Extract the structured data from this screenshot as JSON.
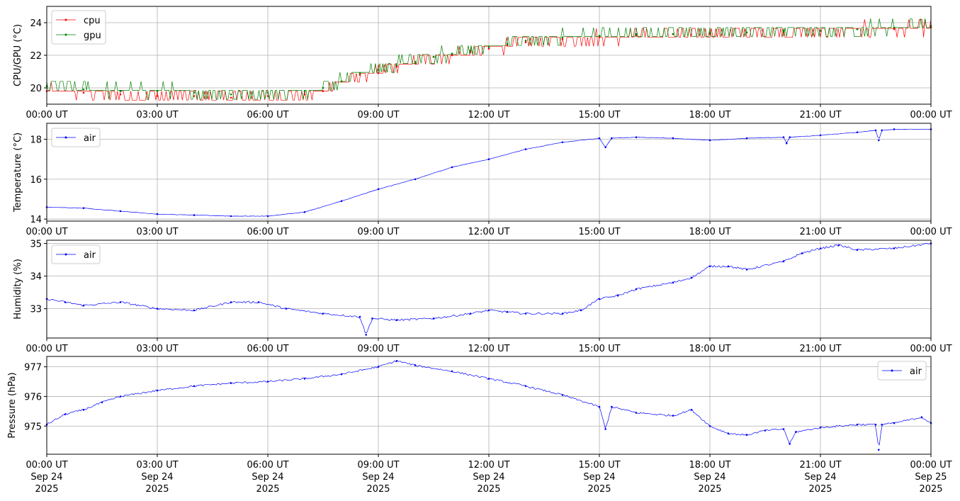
{
  "chart_data": [
    {
      "type": "line",
      "ylabel": "CPU/GPU (°C)",
      "ylim": [
        19.0,
        25.0
      ],
      "yticks": [
        20,
        22,
        24
      ],
      "xlim": [
        "2025-09-24 00:00",
        "2025-09-25 00:00"
      ],
      "xticks": [
        "00:00 UT",
        "03:00 UT",
        "06:00 UT",
        "09:00 UT",
        "12:00 UT",
        "15:00 UT",
        "18:00 UT",
        "21:00 UT",
        "00:00 UT"
      ],
      "grid": true,
      "legend": "top-left",
      "series": [
        {
          "name": "cpu",
          "color": "#ff0000",
          "points": [
            [
              "00:00",
              19.8
            ],
            [
              "01:00",
              19.7
            ],
            [
              "02:00",
              19.6
            ],
            [
              "03:00",
              19.5
            ],
            [
              "04:00",
              19.5
            ],
            [
              "05:00",
              19.4
            ],
            [
              "06:00",
              19.5
            ],
            [
              "07:00",
              19.6
            ],
            [
              "07:30",
              19.8
            ],
            [
              "08:00",
              20.4
            ],
            [
              "08:30",
              20.8
            ],
            [
              "09:00",
              20.9
            ],
            [
              "09:30",
              21.3
            ],
            [
              "10:00",
              21.5
            ],
            [
              "10:30",
              21.9
            ],
            [
              "11:00",
              22.0
            ],
            [
              "11:30",
              22.2
            ],
            [
              "12:00",
              22.4
            ],
            [
              "12:30",
              22.6
            ],
            [
              "13:00",
              22.8
            ],
            [
              "14:00",
              23.0
            ],
            [
              "15:00",
              23.1
            ],
            [
              "16:00",
              23.2
            ],
            [
              "17:00",
              23.3
            ],
            [
              "18:00",
              23.3
            ],
            [
              "19:00",
              23.4
            ],
            [
              "20:00",
              23.4
            ],
            [
              "21:00",
              23.5
            ],
            [
              "22:00",
              23.6
            ],
            [
              "23:00",
              23.6
            ],
            [
              "24:00",
              23.7
            ]
          ]
        },
        {
          "name": "gpu",
          "color": "#008000",
          "points": [
            [
              "00:00",
              20.1
            ],
            [
              "01:00",
              19.9
            ],
            [
              "02:00",
              19.8
            ],
            [
              "03:00",
              19.8
            ],
            [
              "04:00",
              19.7
            ],
            [
              "05:00",
              19.6
            ],
            [
              "06:00",
              19.7
            ],
            [
              "07:00",
              19.8
            ],
            [
              "07:30",
              20.0
            ],
            [
              "08:00",
              20.4
            ],
            [
              "08:30",
              20.9
            ],
            [
              "09:00",
              21.1
            ],
            [
              "09:30",
              21.4
            ],
            [
              "10:00",
              21.6
            ],
            [
              "10:30",
              21.9
            ],
            [
              "11:00",
              22.1
            ],
            [
              "11:30",
              22.3
            ],
            [
              "12:00",
              22.5
            ],
            [
              "12:30",
              22.7
            ],
            [
              "13:00",
              22.9
            ],
            [
              "14:00",
              23.1
            ],
            [
              "15:00",
              23.2
            ],
            [
              "16:00",
              23.3
            ],
            [
              "17:00",
              23.3
            ],
            [
              "18:00",
              23.4
            ],
            [
              "19:00",
              23.4
            ],
            [
              "20:00",
              23.5
            ],
            [
              "21:00",
              23.5
            ],
            [
              "22:00",
              23.6
            ],
            [
              "23:00",
              23.7
            ],
            [
              "24:00",
              23.8
            ]
          ]
        }
      ]
    },
    {
      "type": "line",
      "ylabel": "Temperature (°C)",
      "ylim": [
        13.9,
        18.8
      ],
      "yticks": [
        14,
        16,
        18
      ],
      "xlim": [
        "2025-09-24 00:00",
        "2025-09-25 00:00"
      ],
      "xticks": [
        "00:00 UT",
        "03:00 UT",
        "06:00 UT",
        "09:00 UT",
        "12:00 UT",
        "15:00 UT",
        "18:00 UT",
        "21:00 UT",
        "00:00 UT"
      ],
      "grid": true,
      "legend": "top-left",
      "series": [
        {
          "name": "air",
          "color": "#0000ff",
          "points": [
            [
              "00:00",
              14.6
            ],
            [
              "01:00",
              14.55
            ],
            [
              "02:00",
              14.4
            ],
            [
              "03:00",
              14.25
            ],
            [
              "04:00",
              14.2
            ],
            [
              "05:00",
              14.15
            ],
            [
              "06:00",
              14.15
            ],
            [
              "07:00",
              14.35
            ],
            [
              "08:00",
              14.9
            ],
            [
              "09:00",
              15.5
            ],
            [
              "10:00",
              16.0
            ],
            [
              "11:00",
              16.6
            ],
            [
              "12:00",
              17.0
            ],
            [
              "13:00",
              17.5
            ],
            [
              "14:00",
              17.85
            ],
            [
              "15:00",
              18.05
            ],
            [
              "15:10",
              17.6
            ],
            [
              "15:20",
              18.05
            ],
            [
              "16:00",
              18.1
            ],
            [
              "17:00",
              18.05
            ],
            [
              "18:00",
              17.95
            ],
            [
              "19:00",
              18.05
            ],
            [
              "20:00",
              18.1
            ],
            [
              "20:05",
              17.8
            ],
            [
              "20:10",
              18.1
            ],
            [
              "21:00",
              18.2
            ],
            [
              "22:00",
              18.35
            ],
            [
              "22:30",
              18.45
            ],
            [
              "22:35",
              17.95
            ],
            [
              "22:40",
              18.45
            ],
            [
              "23:00",
              18.5
            ],
            [
              "24:00",
              18.5
            ]
          ]
        }
      ]
    },
    {
      "type": "line",
      "ylabel": "Humidity (%)",
      "ylim": [
        32.1,
        35.1
      ],
      "yticks": [
        33,
        34,
        35
      ],
      "xlim": [
        "2025-09-24 00:00",
        "2025-09-25 00:00"
      ],
      "xticks": [
        "00:00 UT",
        "03:00 UT",
        "06:00 UT",
        "09:00 UT",
        "12:00 UT",
        "15:00 UT",
        "18:00 UT",
        "21:00 UT",
        "00:00 UT"
      ],
      "grid": true,
      "legend": "top-left",
      "series": [
        {
          "name": "air",
          "color": "#0000ff",
          "points": [
            [
              "00:00",
              33.3
            ],
            [
              "00:30",
              33.2
            ],
            [
              "01:00",
              33.1
            ],
            [
              "02:00",
              33.2
            ],
            [
              "03:00",
              33.0
            ],
            [
              "04:00",
              32.95
            ],
            [
              "05:00",
              33.2
            ],
            [
              "05:45",
              33.2
            ],
            [
              "06:30",
              33.0
            ],
            [
              "07:30",
              32.85
            ],
            [
              "08:30",
              32.75
            ],
            [
              "08:40",
              32.2
            ],
            [
              "08:50",
              32.7
            ],
            [
              "09:30",
              32.65
            ],
            [
              "10:30",
              32.7
            ],
            [
              "11:30",
              32.85
            ],
            [
              "12:00",
              32.95
            ],
            [
              "12:30",
              32.9
            ],
            [
              "13:00",
              32.85
            ],
            [
              "14:00",
              32.85
            ],
            [
              "14:30",
              32.95
            ],
            [
              "15:00",
              33.3
            ],
            [
              "15:30",
              33.4
            ],
            [
              "16:00",
              33.6
            ],
            [
              "17:00",
              33.8
            ],
            [
              "17:30",
              33.95
            ],
            [
              "18:00",
              34.3
            ],
            [
              "18:30",
              34.3
            ],
            [
              "19:00",
              34.2
            ],
            [
              "20:00",
              34.45
            ],
            [
              "20:30",
              34.7
            ],
            [
              "21:00",
              34.85
            ],
            [
              "21:30",
              34.95
            ],
            [
              "22:00",
              34.8
            ],
            [
              "23:00",
              34.85
            ],
            [
              "24:00",
              35.0
            ]
          ]
        }
      ]
    },
    {
      "type": "line",
      "ylabel": "Pressure (hPa)",
      "ylim": [
        974.05,
        977.35
      ],
      "yticks": [
        975,
        976,
        977
      ],
      "xlim": [
        "2025-09-24 00:00",
        "2025-09-25 00:00"
      ],
      "xticks": [
        "00:00 UT",
        "03:00 UT",
        "06:00 UT",
        "09:00 UT",
        "12:00 UT",
        "15:00 UT",
        "18:00 UT",
        "21:00 UT",
        "00:00 UT"
      ],
      "xtick_dates": [
        "Sep 24",
        "Sep 24",
        "Sep 24",
        "Sep 24",
        "Sep 24",
        "Sep 24",
        "Sep 24",
        "Sep 24",
        "Sep 25"
      ],
      "xtick_years": [
        "2025",
        "2025",
        "2025",
        "2025",
        "2025",
        "2025",
        "2025",
        "2025",
        "2025"
      ],
      "grid": true,
      "legend": "top-right",
      "series": [
        {
          "name": "air",
          "color": "#0000ff",
          "points": [
            [
              "00:00",
              975.05
            ],
            [
              "00:30",
              975.4
            ],
            [
              "01:00",
              975.55
            ],
            [
              "01:30",
              975.8
            ],
            [
              "02:00",
              976.0
            ],
            [
              "03:00",
              976.2
            ],
            [
              "04:00",
              976.35
            ],
            [
              "05:00",
              976.45
            ],
            [
              "06:00",
              976.5
            ],
            [
              "07:00",
              976.6
            ],
            [
              "08:00",
              976.75
            ],
            [
              "09:00",
              977.0
            ],
            [
              "09:30",
              977.2
            ],
            [
              "10:00",
              977.05
            ],
            [
              "11:00",
              976.85
            ],
            [
              "12:00",
              976.6
            ],
            [
              "13:00",
              976.35
            ],
            [
              "14:00",
              976.05
            ],
            [
              "15:00",
              975.65
            ],
            [
              "15:10",
              974.9
            ],
            [
              "15:20",
              975.65
            ],
            [
              "16:00",
              975.45
            ],
            [
              "17:00",
              975.35
            ],
            [
              "17:30",
              975.55
            ],
            [
              "18:00",
              975.0
            ],
            [
              "18:30",
              974.75
            ],
            [
              "19:00",
              974.7
            ],
            [
              "19:30",
              974.85
            ],
            [
              "20:00",
              974.9
            ],
            [
              "20:10",
              974.4
            ],
            [
              "20:20",
              974.8
            ],
            [
              "21:00",
              974.95
            ],
            [
              "22:00",
              975.05
            ],
            [
              "22:30",
              975.05
            ],
            [
              "22:35",
              974.2
            ],
            [
              "22:40",
              975.05
            ],
            [
              "23:00",
              975.1
            ],
            [
              "23:45",
              975.3
            ],
            [
              "24:00",
              975.1
            ]
          ]
        }
      ]
    }
  ]
}
